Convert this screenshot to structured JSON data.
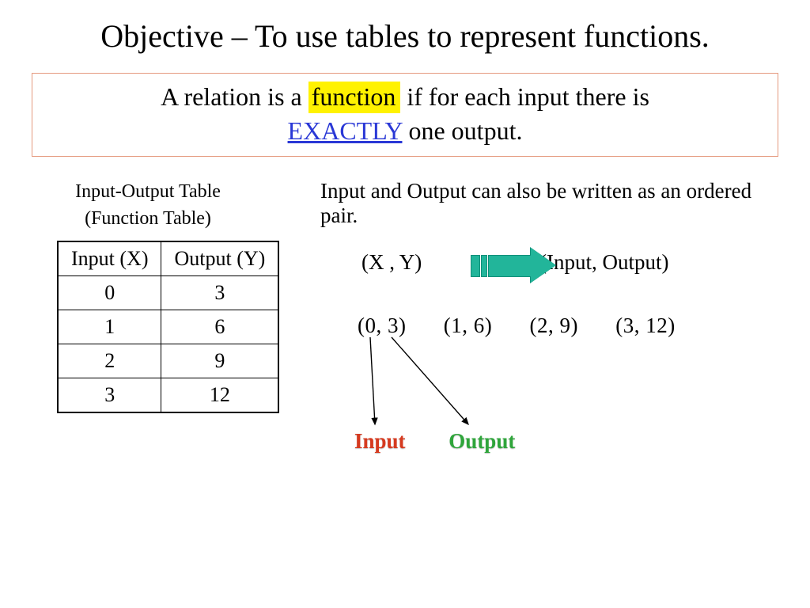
{
  "title": "Objective – To use tables to represent functions.",
  "definition": {
    "part1": "A relation is a",
    "highlight": "function",
    "part2": " if for each input there is ",
    "emphasis": "EXACTLY",
    "part3": " one output."
  },
  "table": {
    "caption_line1": "Input-Output Table",
    "caption_line2": "(Function Table)",
    "head_input": "Input (X)",
    "head_output": "Output (Y)",
    "rows": [
      {
        "x": "0",
        "y": "3"
      },
      {
        "x": "1",
        "y": "6"
      },
      {
        "x": "2",
        "y": "9"
      },
      {
        "x": "3",
        "y": "12"
      }
    ]
  },
  "right": {
    "note": "Input and Output can also be written as an ordered pair.",
    "xy": "(X , Y)",
    "io": "(Input, Output)",
    "pairs": [
      "(0, 3)",
      "(1, 6)",
      "(2, 9)",
      "(3, 12)"
    ],
    "label_input": "Input",
    "label_output": "Output"
  },
  "chart_data": {
    "type": "table",
    "title": "Input-Output Table (Function Table)",
    "columns": [
      "Input (X)",
      "Output (Y)"
    ],
    "rows": [
      [
        0,
        3
      ],
      [
        1,
        6
      ],
      [
        2,
        9
      ],
      [
        3,
        12
      ]
    ],
    "ordered_pairs": [
      [
        0,
        3
      ],
      [
        1,
        6
      ],
      [
        2,
        9
      ],
      [
        3,
        12
      ]
    ]
  }
}
